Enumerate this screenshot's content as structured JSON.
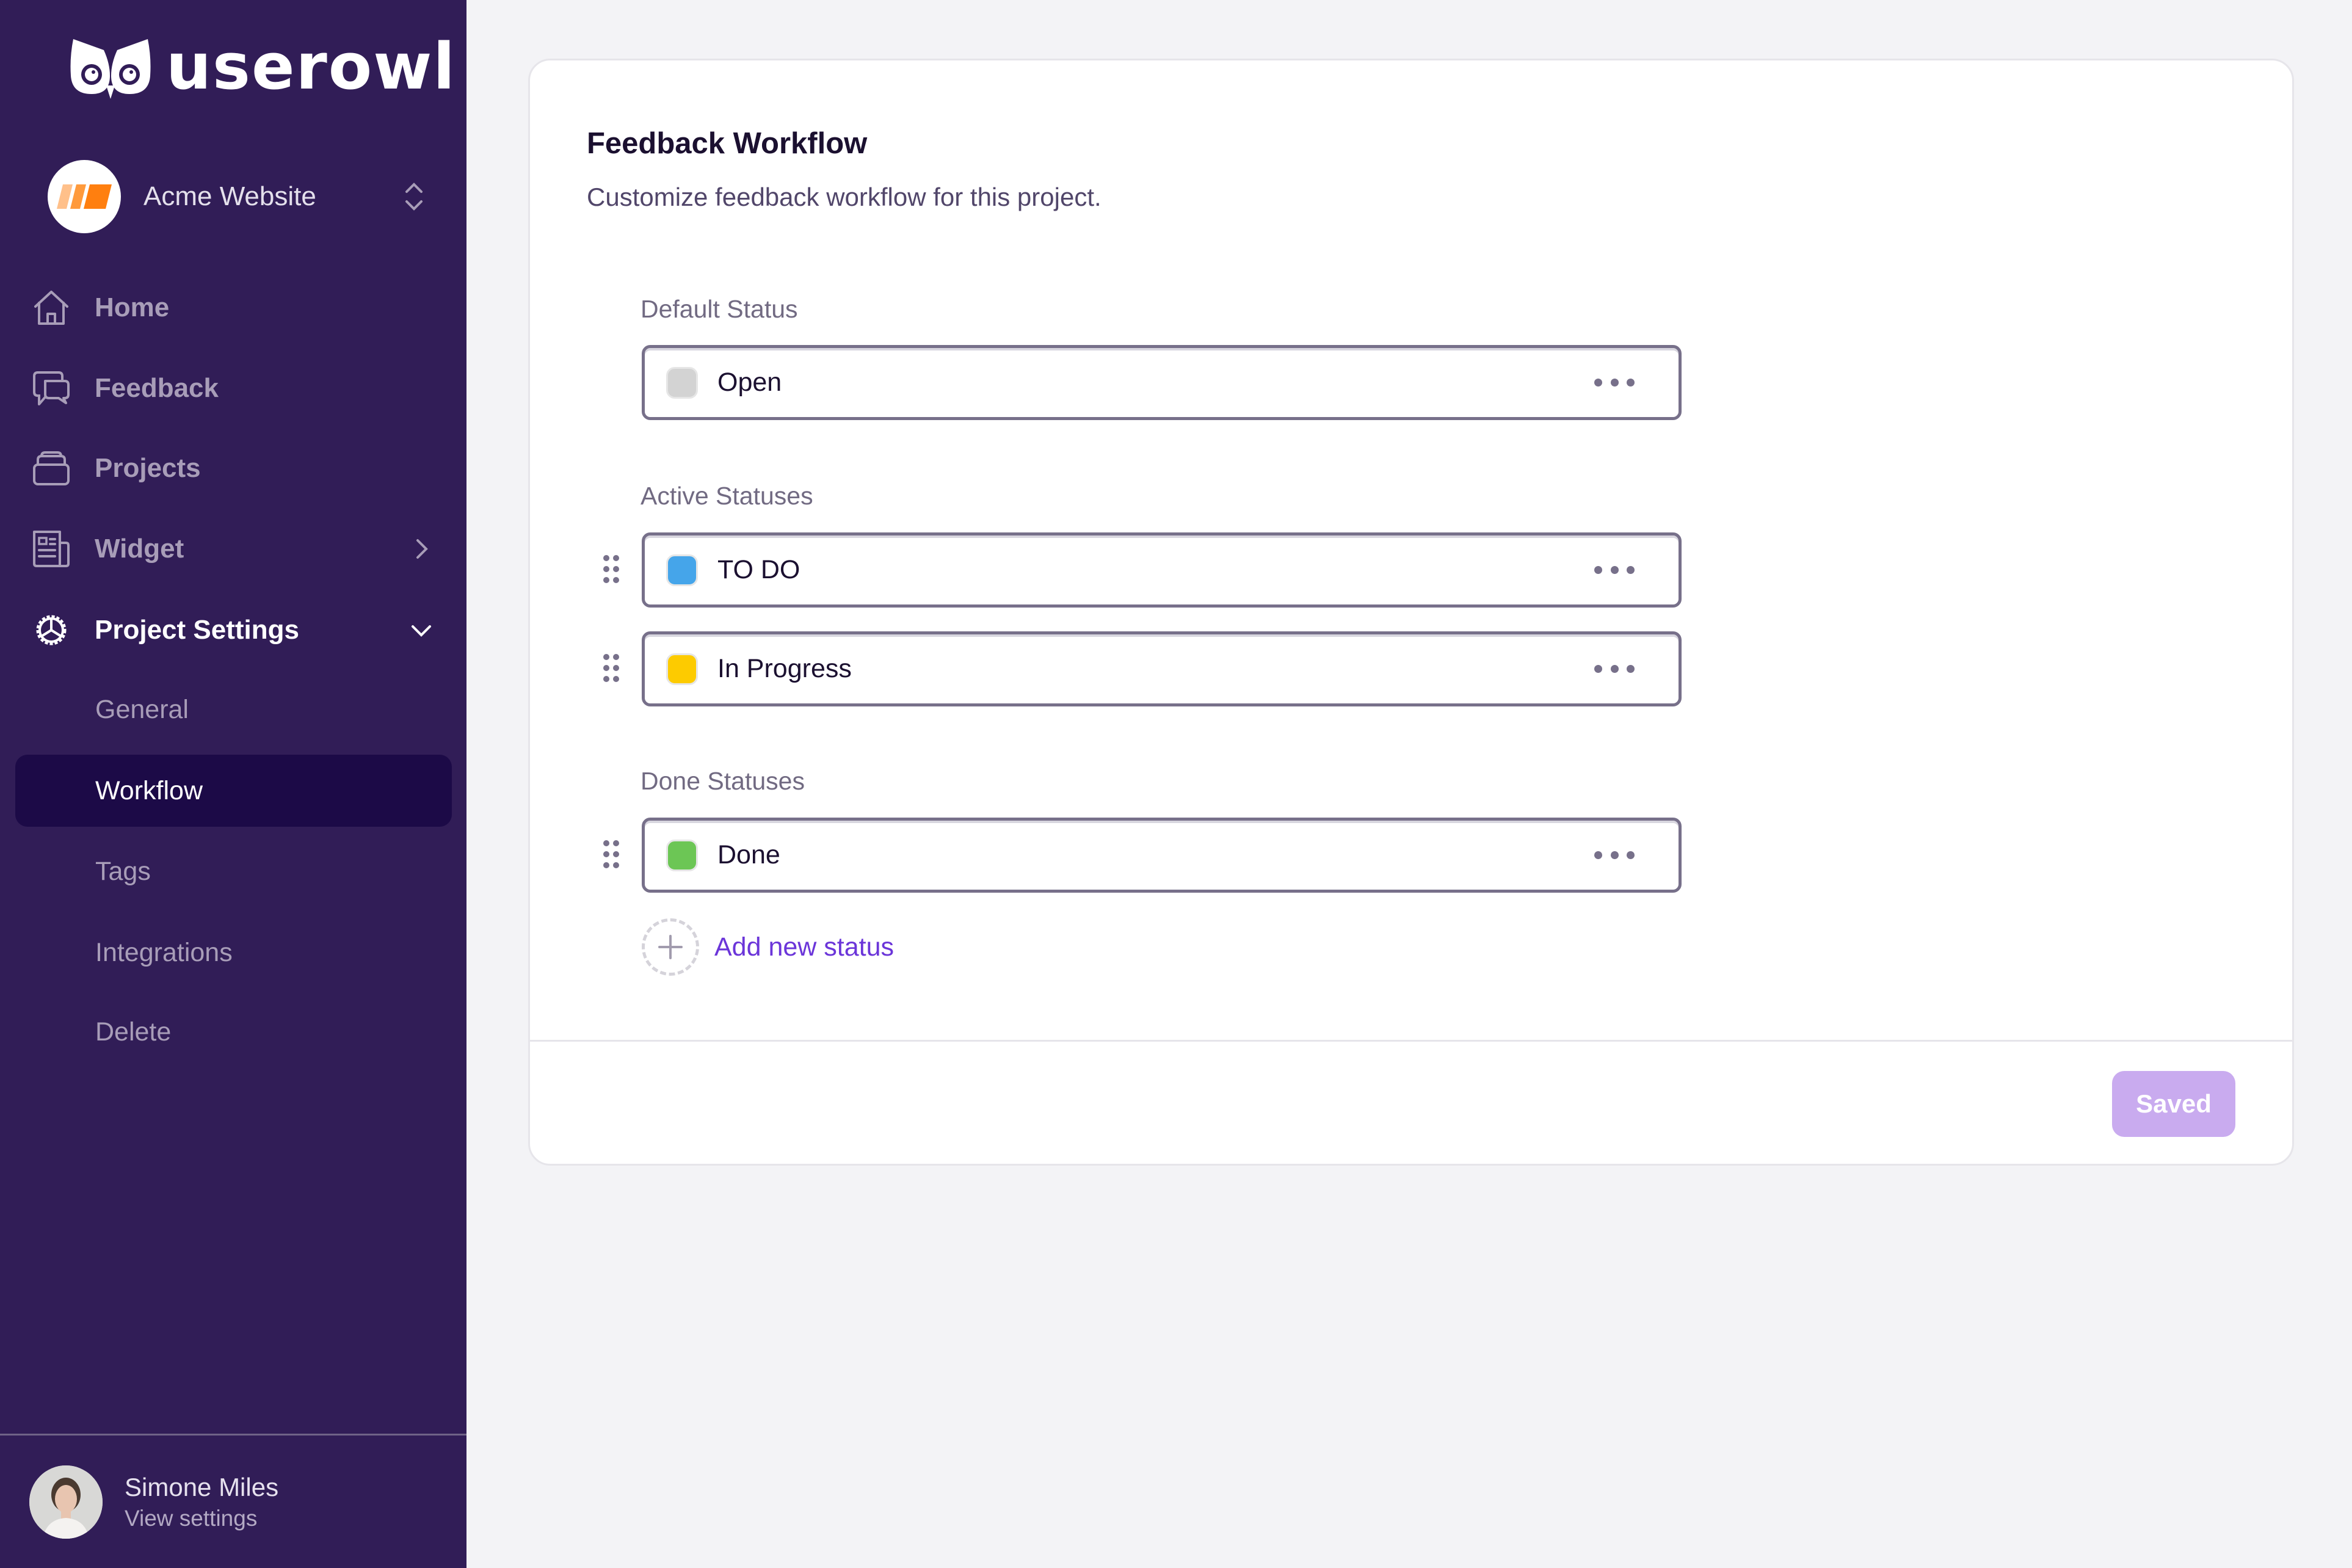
{
  "brand": {
    "name": "userowl"
  },
  "project": {
    "name": "Acme Website"
  },
  "nav": {
    "items": [
      {
        "label": "Home"
      },
      {
        "label": "Feedback"
      },
      {
        "label": "Projects"
      },
      {
        "label": "Widget"
      },
      {
        "label": "Project Settings"
      }
    ],
    "sub_items": [
      {
        "label": "General"
      },
      {
        "label": "Workflow"
      },
      {
        "label": "Tags"
      },
      {
        "label": "Integrations"
      },
      {
        "label": "Delete"
      }
    ]
  },
  "user": {
    "name": "Simone Miles",
    "link": "View settings"
  },
  "main": {
    "title": "Feedback Workflow",
    "subtitle": "Customize feedback workflow for this project.",
    "default_label": "Default Status",
    "active_label": "Active Statuses",
    "done_label": "Done Statuses",
    "statuses": {
      "default": {
        "name": "Open",
        "color": "#d3d3d3"
      },
      "active": [
        {
          "name": "TO DO",
          "color": "#45a5ea"
        },
        {
          "name": "In Progress",
          "color": "#fdcb00"
        }
      ],
      "done": [
        {
          "name": "Done",
          "color": "#6cc655"
        }
      ]
    },
    "add_status_label": "Add new status",
    "save_label": "Saved"
  },
  "colors": {
    "sidebar_bg": "#311d57",
    "sidebar_active_bg": "#1c0a47",
    "accent": "#6b35d9",
    "saved_button": "#c9abef"
  }
}
